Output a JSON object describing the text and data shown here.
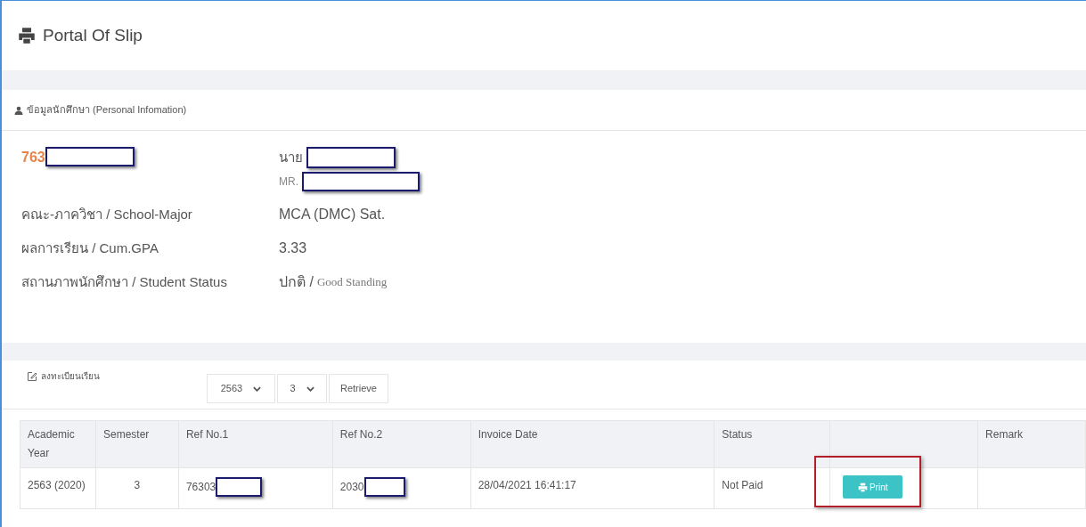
{
  "page_title": "Portal Of Slip",
  "personal": {
    "heading": "ข้อมูลนักศึกษา (Personal Infomation)",
    "student_id": "763",
    "name_th_prefix": "นาย",
    "name_en_prefix": "MR.",
    "fields": [
      {
        "label": "คณะ-ภาควิชา / School-Major",
        "value": "MCA (DMC) Sat."
      },
      {
        "label": "ผลการเรียน / Cum.GPA",
        "value": "3.33"
      },
      {
        "label": "สถานภาพนักศึกษา / Student Status",
        "value": "ปกติ /",
        "note": "Good Standing"
      }
    ]
  },
  "registration": {
    "heading": "ลงทะเบียนเรียน",
    "year_select": "2563",
    "semester_select": "3",
    "retrieve_button": "Retrieve",
    "columns": [
      "Academic Year",
      "Semester",
      "Ref No.1",
      "Ref No.2",
      "Invoice Date",
      "Status",
      "",
      "Remark"
    ],
    "rows": [
      {
        "year": "2563 (2020)",
        "semester": "3",
        "ref1": "76303",
        "ref2": "2030",
        "invoice_date": "28/04/2021 16:41:17",
        "status": "Not Paid",
        "action": "Print",
        "highlighted": true
      }
    ]
  }
}
